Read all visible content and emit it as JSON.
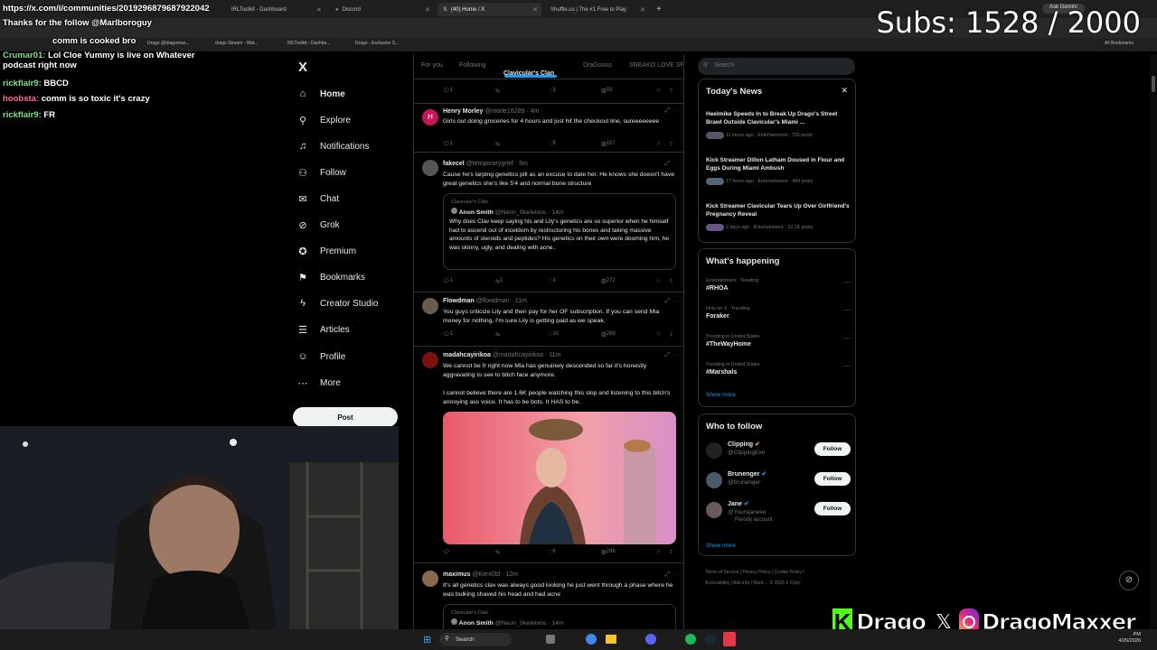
{
  "browser": {
    "tabs": [
      {
        "label": "IRLToolkit - Dashboard"
      },
      {
        "label": "Discord"
      },
      {
        "label": "(40) Home / X"
      },
      {
        "label": "Shuffle.us | The #1 Free to Play"
      }
    ],
    "url": "https://x.com/i/communities/2019296879687922042",
    "ask_gemini": "Ask Gemini",
    "bookmarks": [
      "Drago @dragomax...",
      "drago Stream - Wat...",
      "IRLToolkit - Dashbo...",
      "Drago - Exclusive S..."
    ],
    "all_bookmarks": "All Bookmarks"
  },
  "stream": {
    "subs_counter": "Subs: 1528 / 2000",
    "chat": [
      {
        "user": "Crumar01:",
        "msg": "Lol Cloe Yummy is live on Whatever podcast right now"
      },
      {
        "user": "rickflair9:",
        "msg": "BBCD"
      },
      {
        "user": "hoobsta:",
        "msg": "comm is so toxic it's crazy"
      },
      {
        "user": "rickflair9:",
        "msg": "FR"
      }
    ],
    "chat_partial": [
      {
        "msg": "Thanks for the follow @Marlboroguy"
      },
      {
        "msg": "comm is cooked bro"
      }
    ],
    "overlay": {
      "kick_name": "Drago",
      "ig_name": "DragoMaxxer"
    }
  },
  "nav": {
    "logo": "X",
    "items": [
      {
        "label": "Home",
        "icon": "home-icon"
      },
      {
        "label": "Explore",
        "icon": "search-icon"
      },
      {
        "label": "Notifications",
        "icon": "bell-icon"
      },
      {
        "label": "Follow",
        "icon": "person-add-icon"
      },
      {
        "label": "Chat",
        "icon": "mail-icon"
      },
      {
        "label": "Grok",
        "icon": "grok-icon"
      },
      {
        "label": "Premium",
        "icon": "x-premium-icon"
      },
      {
        "label": "Bookmarks",
        "icon": "bookmark-icon"
      },
      {
        "label": "Creator Studio",
        "icon": "lightning-icon"
      },
      {
        "label": "Articles",
        "icon": "article-icon"
      },
      {
        "label": "Profile",
        "icon": "profile-icon"
      },
      {
        "label": "More",
        "icon": "more-icon"
      }
    ],
    "post_label": "Post"
  },
  "feed": {
    "tabs": [
      "For you",
      "Following",
      "Clavicular's Clan",
      "DraGoons",
      "SNEAKO LOVE SF"
    ],
    "top_counts": {
      "reply": "1",
      "like": "3",
      "views": "93"
    },
    "tweets": [
      {
        "name": "Henry Morley",
        "handle": "@morle16289 · 4m",
        "avatar": "H",
        "text": "Girls out doing groceries for 4 hours and just hit the checkout line, sureeeeeeee",
        "reply": "1",
        "retweet": "",
        "like": "8",
        "views": "107"
      },
      {
        "name": "fakecel",
        "handle": "@temporarygrief · 5m",
        "text": "Cause he's larping genetics pill as an excuse to date her. He knows she doesn't have great genetics she's like 5'4 and normal bone structure",
        "quote": {
          "community": "Clavicular's Clan",
          "name": "Anon Smith",
          "handle": "@Neon_Skeletons · 14m",
          "text": "Why does Clav keep saying his and Lily's genetics are so superior when he himself had to ascend out of inceldom by restructuring his bones and taking massive amounts of steroids and peptides? His genetics on their own were dooming him, he was skinny, ugly, and dealing with acne.."
        },
        "reply": "1",
        "retweet": "1",
        "like": "3",
        "views": "272"
      },
      {
        "name": "Flowdman",
        "handle": "@flowdman · 11m",
        "text": "You guys criticize Lily and then pay for her OF subscription. If you can send Mia money for nothing, I'm sure Lily is getting paid as we speak.",
        "reply": "1",
        "retweet": "",
        "like": "10",
        "views": "269"
      },
      {
        "name": "madahcayirikoa",
        "handle": "@madahcayirikoa · 11m",
        "text": "We cannot be fr right now Mia has genuinely descended so far it's honestly aggravating to see to bitch face anymore.",
        "text2": "I cannot believe there are 1.6K people watching this slop and listening to this bitch's annoying ass voice. It has to be bots. It HAS to be.",
        "reply": "",
        "retweet": "",
        "like": "6",
        "views": "296"
      },
      {
        "name": "maximus",
        "handle": "@Kent0ld · 12m",
        "text": "It's all genetics clav was always good looking he just went through a phase where he was bulking shaved his head and had acne",
        "quote": {
          "community": "Clavicular's Clan",
          "name": "Anon Smith",
          "handle": "@Neon_Skeletons · 14m"
        }
      }
    ]
  },
  "sidebar": {
    "search_placeholder": "Search",
    "news_title": "Today's News",
    "news": [
      {
        "headline": "Heelmike Speeds In to Break Up Drago's Street Brawl Outside Clavicular's Miami ...",
        "meta": "11 hours ago · Entertainment · 705 posts"
      },
      {
        "headline": "Kick Streamer Dillon Latham Doused in Flour and Eggs During Miami Ambush",
        "meta": "17 hours ago · Entertainment · 409 posts"
      },
      {
        "headline": "Kick Streamer Clavicular Tears Up Over Girlfriend's Pregnancy Reveal",
        "meta": "2 days ago · Entertainment · 22.1K posts"
      }
    ],
    "happening_title": "What's happening",
    "trends": [
      {
        "meta": "Entertainment · Trending",
        "tag": "#RHOA"
      },
      {
        "meta": "Only on X · Trending",
        "tag": "Foraker"
      },
      {
        "meta": "Trending in United States",
        "tag": "#TheWayHome"
      },
      {
        "meta": "Trending in United States",
        "tag": "#Marshals"
      }
    ],
    "show_more": "Show more",
    "wtf_title": "Who to follow",
    "follow_label": "Follow",
    "who_to_follow": [
      {
        "name": "Clipping",
        "handle": "@ClippingExe",
        "parody": ""
      },
      {
        "name": "Brunenger",
        "handle": "@brunenger",
        "parody": ""
      },
      {
        "name": "Jane",
        "handle": "@Yoursjaneee",
        "parody": "Parody account"
      }
    ],
    "footer": [
      "Terms of Service",
      "Privacy Policy",
      "Cookie Policy",
      "Accessibility",
      "Ads info",
      "More ...",
      "© 2026 X Corp."
    ]
  },
  "taskbar": {
    "search_label": "Search",
    "clock_time": "PM",
    "clock_date": "4/26/2026"
  },
  "colors": {
    "accent": "#1d9bf0",
    "chat_user": "#7fe08a",
    "kick_green": "#53fc18"
  }
}
